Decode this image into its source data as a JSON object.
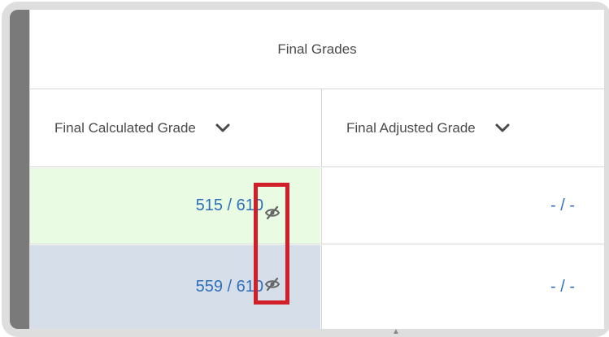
{
  "table": {
    "group_header": "Final Grades",
    "columns": [
      {
        "label": "Final Calculated Grade"
      },
      {
        "label": "Final Adjusted Grade"
      }
    ],
    "rows": [
      {
        "calculated": "515 / 610",
        "adjusted": "- / -"
      },
      {
        "calculated": "559 / 610",
        "adjusted": "- / -"
      }
    ]
  },
  "icons": {
    "column_menu": "chevron-down-icon",
    "hidden_grade": "eye-slash-icon"
  },
  "colors": {
    "link_blue": "#2e6fba",
    "row1_bg": "#eafbe3",
    "row2_bg": "#d6deea",
    "highlight": "#d11f2a"
  }
}
